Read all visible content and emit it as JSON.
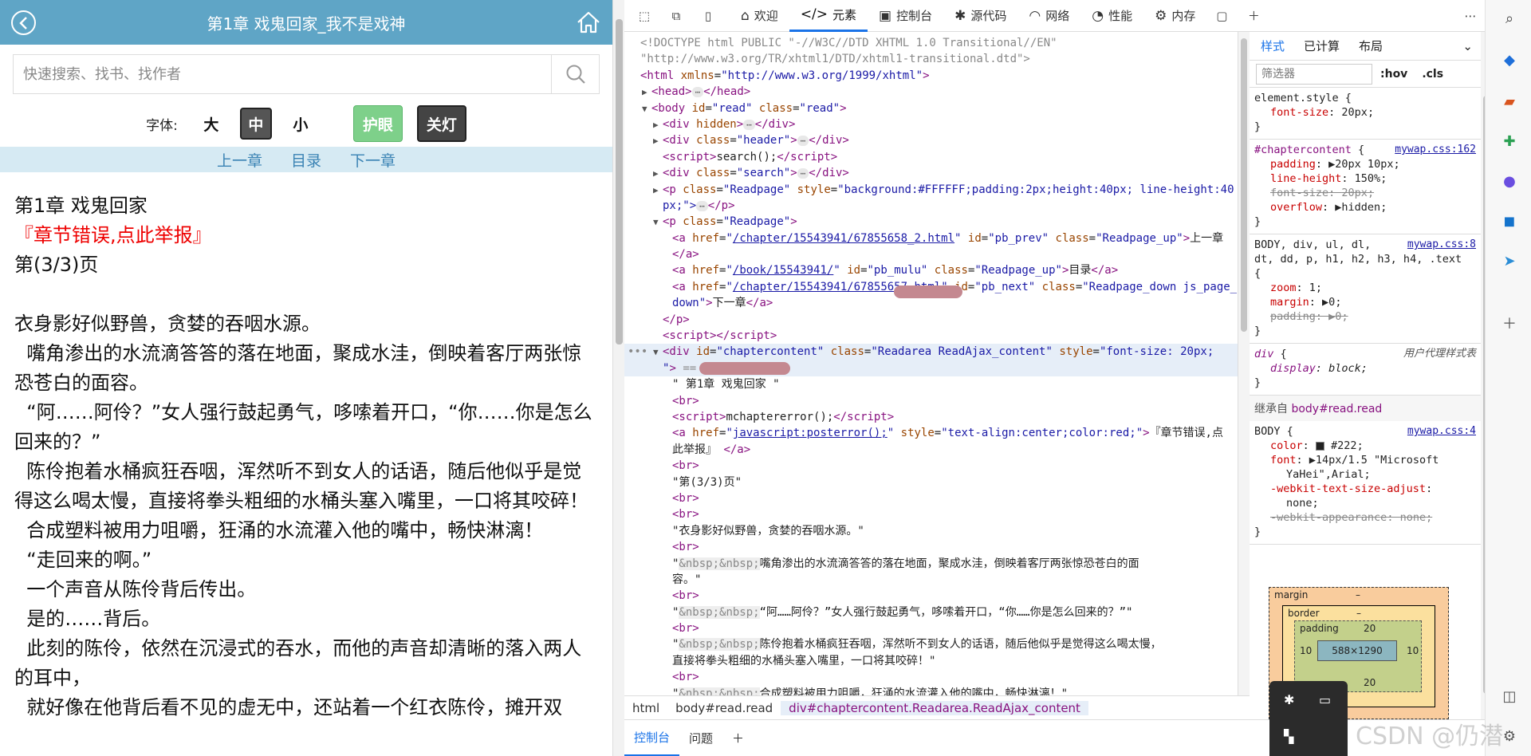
{
  "reader": {
    "header_title": "第1章 戏鬼回家_我不是戏神",
    "search_placeholder": "快速搜索、找书、找作者",
    "font_label": "字体:",
    "font_large": "大",
    "font_medium": "中",
    "font_small": "小",
    "eye_mode": "护眼",
    "lights_off": "关灯",
    "nav_prev": "上一章",
    "nav_toc": "目录",
    "nav_next": "下一章",
    "chapter_title": "第1章 戏鬼回家",
    "report_error": "『章节错误,点此举报』",
    "page_indicator": "第(3/3)页",
    "paragraphs": [
      "衣身影好似野兽，贪婪的吞咽水源。",
      "  嘴角渗出的水流滴答答的落在地面，聚成水洼，倒映着客厅两张惊恐苍白的面容。",
      "  “阿……阿伶？”女人强行鼓起勇气，哆嗦着开口，“你……你是怎么回来的？”",
      "  陈伶抱着水桶疯狂吞咽，浑然听不到女人的话语，随后他似乎是觉得这么喝太慢，直接将拳头粗细的水桶头塞入嘴里，一口将其咬碎！",
      "  合成塑料被用力咀嚼，狂涌的水流灌入他的嘴中，畅快淋漓！",
      "  “走回来的啊。”",
      "  一个声音从陈伶背后传出。",
      "  是的……背后。",
      "  此刻的陈伶，依然在沉浸式的吞水，而他的声音却清晰的落入两人的耳中，",
      "  就好像在他背后看不见的虚无中，还站着一个红衣陈伶，摊开双"
    ]
  },
  "devtools": {
    "tabs": [
      "欢迎",
      "元素",
      "控制台",
      "源代码",
      "网络",
      "性能",
      "内存"
    ],
    "dom": {
      "doctype1": "<!DOCTYPE html PUBLIC \"-//W3C//DTD XHTML 1.0 Transitional//EN\"",
      "doctype2": "\"http://www.w3.org/TR/xhtml1/DTD/xhtml1-transitional.dtd\">",
      "html_xmlns": "http://www.w3.org/1999/xhtml",
      "body_id": "read",
      "body_class": "read",
      "readpage_style": "background:#FFFFFF;padding:2px;height:40px; line-height:40",
      "readpage_style_cont": "px;\">",
      "prev_href": "/chapter/15543941/67855658_2.html",
      "prev_text": "上一章",
      "toc_href": "/book/15543941/",
      "toc_text": "目录",
      "next_href": "/chapter/15543941/67855657.html",
      "next_text": "下一章",
      "chapter_text": "\" 第1章 戏鬼回家 \"",
      "script_mchapter": "mchaptererror();",
      "report_href": "javascript:posterror();",
      "report_style": "text-align:center;color:red;",
      "report_text": "『章节错误,点",
      "report_text2": "此举报』",
      "page_text": "\"第(3/3)页\"",
      "p1": "\"衣身影好似野兽，贪婪的吞咽水源。\"",
      "p2a": "嘴角渗出的水流滴答答的落在地面，聚成水洼，倒映着客厅两张惊恐苍白的面",
      "p2b": "容。\"",
      "p3": "“阿……阿伶？”女人强行鼓起勇气，哆嗦着开口，“你……你是怎么回来的？”\"",
      "p4a": "陈伶抱着水桶疯狂吞咽，浑然听不到女人的话语，随后他似乎是觉得这么喝太慢，",
      "p4b": "直接将拳头粗细的水桶头塞入嘴里，一口将其咬碎！\"",
      "p5": "合成塑料被用力咀嚼，狂涌的水流灌入他的嘴中，畅快淋漓！\""
    },
    "breadcrumb": [
      "html",
      "body#read.read",
      "div#chaptercontent.Readarea.ReadAjax_content"
    ],
    "drawer_tabs": [
      "控制台",
      "问题"
    ],
    "styles": {
      "tabs": [
        "样式",
        "已计算",
        "布局"
      ],
      "filter_placeholder": "筛选器",
      "hov": ":hov",
      "cls": ".cls",
      "element_style_font": "20px",
      "chaptercontent_src": "mywap.css:162",
      "chaptercontent_padding": "20px 10px",
      "chaptercontent_lineheight": "150%",
      "chaptercontent_fontsize": "20px",
      "chaptercontent_overflow": "hidden",
      "body_src": "mywap.css:8",
      "body_sel1": "BODY, div, ul, dl,",
      "body_sel2": "dt, dd, p, h1, h2, h3, h4, .text",
      "zoom": "1",
      "margin": "0",
      "padding": "0",
      "ua_label": "用户代理样式表",
      "display": "block",
      "inherit_label": "继承自",
      "inherit_sel": "body#read.read",
      "body2_src": "mywap.css:4",
      "color": "#222",
      "font": "14px/1.5 \"Microsoft",
      "font2": "YaHei\",Arial;",
      "text_adjust": "none",
      "appearance": "none",
      "bm_margin": "margin",
      "bm_border": "border",
      "bm_padding": "padding",
      "bm_dash": "–",
      "bm_pad_top": "20",
      "bm_pad_side": "10",
      "bm_pad_bottom": "20",
      "bm_content": "588×1290"
    }
  },
  "watermark": "CSDN @仍潜"
}
